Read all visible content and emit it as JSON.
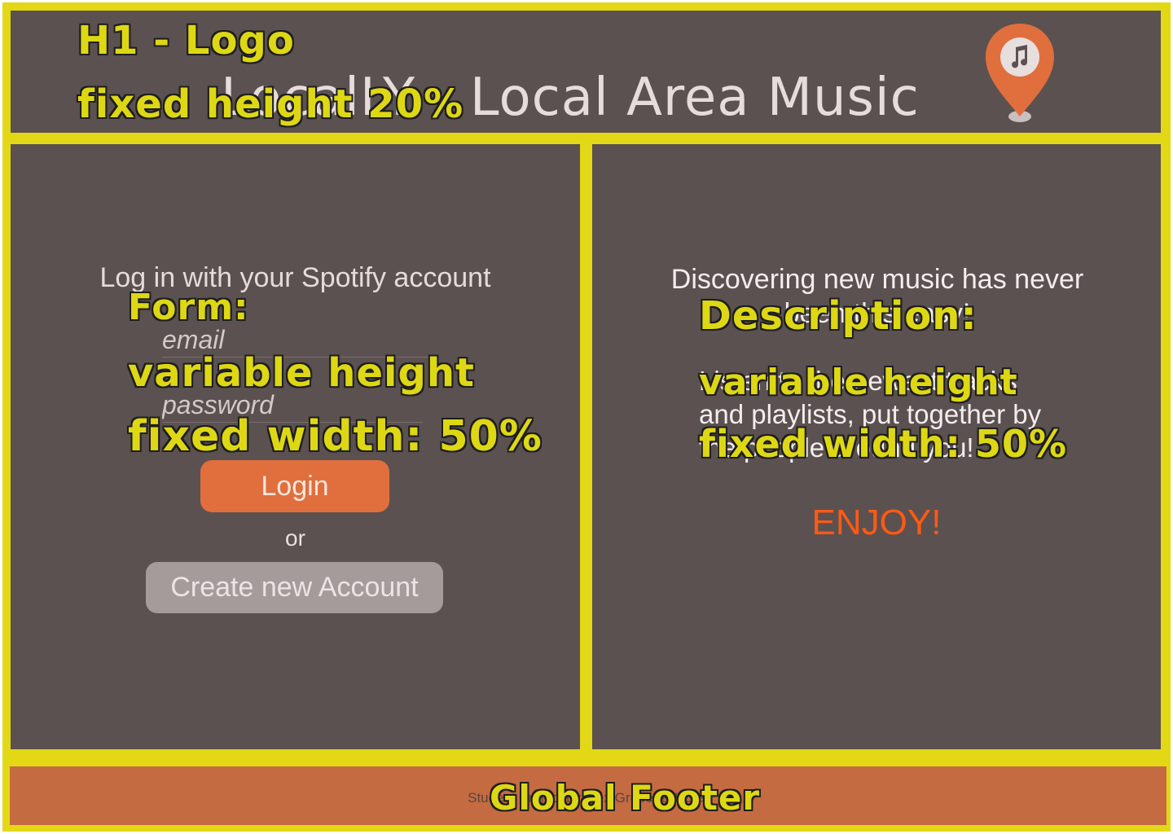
{
  "header": {
    "title": "LocalLY - Local Area Music",
    "logo_icon": "music-note-location-pin-icon"
  },
  "login": {
    "heading": "Log in with your Spotify account",
    "email_placeholder": "email",
    "password_placeholder": "password",
    "login_label": "Login",
    "or_text": "or",
    "create_label": "Create new Account"
  },
  "description": {
    "headline": "Discovering new music has never been this easy!",
    "body": "Listen to the newest tracks and playlists, put together by the people around you!",
    "enjoy": "ENJOY!"
  },
  "footer": {
    "text": "Student Project by Alex Gruber & Hofer"
  },
  "annotations": {
    "header_line1": "H1 - Logo",
    "header_line2": "fixed height 20%",
    "form_line1": "Form:",
    "form_line2": "variable height",
    "form_line3": "fixed width: 50%",
    "desc_line1": "Description:",
    "desc_line2": "variable height",
    "desc_line3": "fixed width: 50%",
    "footer_label": "Global Footer"
  },
  "colors": {
    "annotation_yellow": "#e2d816",
    "panel_bg": "#5b5150",
    "accent_orange": "#e06f3d",
    "footer_bg": "#c56b41",
    "enjoy_red": "#ff5a14"
  }
}
